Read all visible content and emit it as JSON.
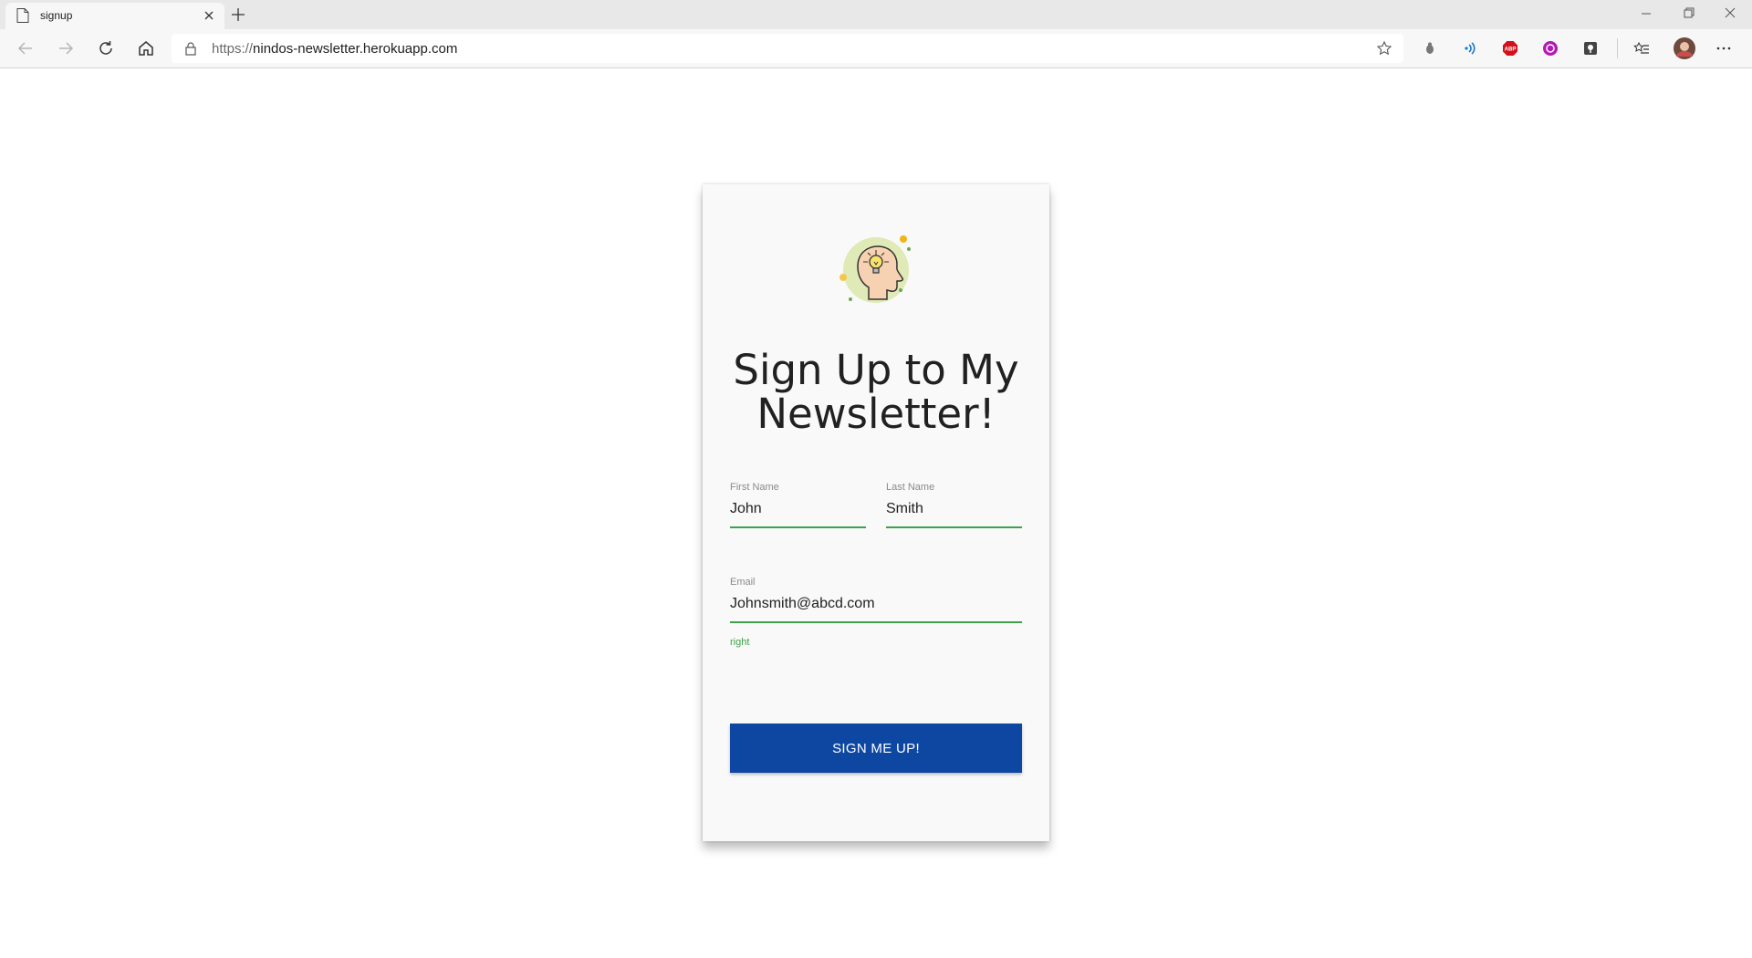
{
  "browser": {
    "tab_title": "signup",
    "url_protocol": "https://",
    "url_host": "nindos-newsletter.herokuapp.com"
  },
  "form": {
    "heading": "Sign Up to My Newsletter!",
    "first_name_label": "First Name",
    "first_name_value": "John",
    "last_name_label": "Last Name",
    "last_name_value": "Smith",
    "email_label": "Email",
    "email_value": "Johnsmith@abcd.com",
    "email_helper": "right",
    "submit_label": "SIGN ME UP!"
  },
  "colors": {
    "accent_button": "#0e47a1",
    "valid_green": "#3fa14a"
  },
  "icons": [
    "page-icon",
    "close-icon",
    "plus-icon",
    "minimize-icon",
    "restore-icon",
    "close-window-icon",
    "back-icon",
    "forward-icon",
    "refresh-icon",
    "home-icon",
    "lock-icon",
    "star-icon",
    "bug-icon",
    "wifi-icon",
    "adblock-icon",
    "extension-icon",
    "reader-icon",
    "favorites-icon",
    "avatar",
    "more-icon",
    "brain-idea-icon"
  ]
}
